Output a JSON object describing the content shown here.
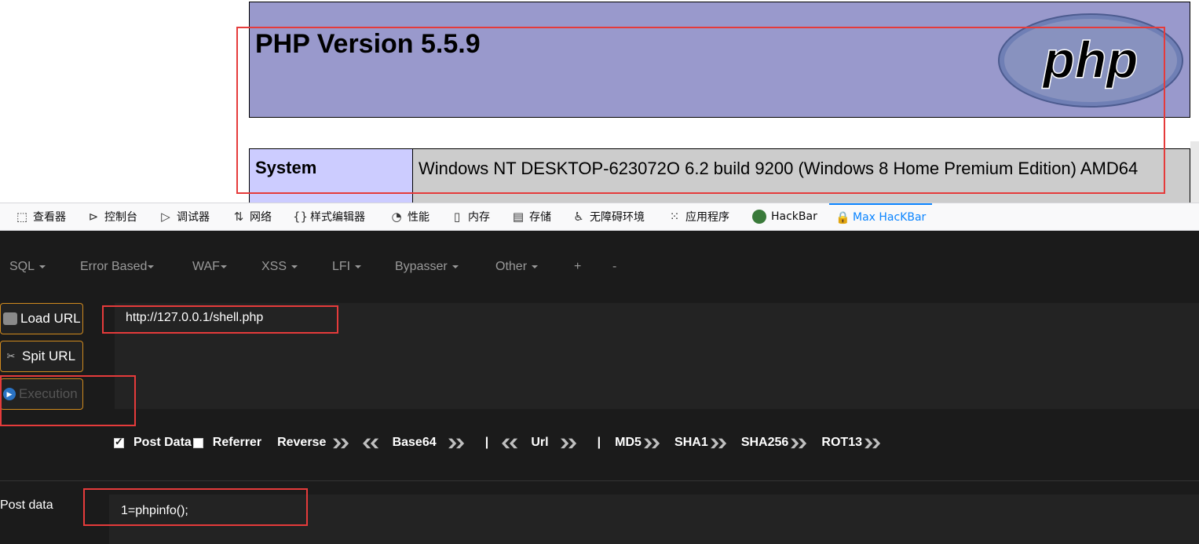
{
  "phpinfo": {
    "title": "PHP Version 5.5.9",
    "logo_text": "php",
    "system_key": "System",
    "system_value": "Windows NT DESKTOP-623072O 6.2 build 9200 (Windows 8 Home Premium Edition) AMD64"
  },
  "devtools": {
    "tabs": [
      {
        "label": "查看器",
        "icon": "inspector-icon"
      },
      {
        "label": "控制台",
        "icon": "console-icon"
      },
      {
        "label": "调试器",
        "icon": "debugger-icon"
      },
      {
        "label": "网络",
        "icon": "network-icon"
      },
      {
        "label": "样式编辑器",
        "icon": "style-editor-icon"
      },
      {
        "label": "性能",
        "icon": "performance-icon"
      },
      {
        "label": "内存",
        "icon": "memory-icon"
      },
      {
        "label": "存储",
        "icon": "storage-icon"
      },
      {
        "label": "无障碍环境",
        "icon": "accessibility-icon"
      },
      {
        "label": "应用程序",
        "icon": "application-icon"
      },
      {
        "label": "HackBar",
        "icon": "hackbar-icon"
      },
      {
        "label": "Max HacKBar",
        "icon": "max-hackbar-icon"
      }
    ],
    "active_tab": "Max HacKBar",
    "active_color": "#0a84ff"
  },
  "hackbar": {
    "menu": [
      "SQL",
      "Error Based",
      "WAF",
      "XSS",
      "LFI",
      "Bypasser",
      "Other",
      "+",
      "-"
    ],
    "buttons": {
      "load_url": "Load URL",
      "split_url": "Spit URL",
      "execution": "Execution"
    },
    "url_value": "http://127.0.0.1/shell.php",
    "options": {
      "post_data": "Post Data",
      "post_data_checked": true,
      "referrer": "Referrer",
      "referrer_checked": false,
      "reverse": "Reverse",
      "base64": "Base64",
      "sep1": "|",
      "url": "Url",
      "sep2": "|",
      "md5": "MD5",
      "sha1": "SHA1",
      "sha256": "SHA256",
      "rot13": "ROT13"
    },
    "post_label": "Post data",
    "post_value": "1=phpinfo();",
    "border_accent": "#d08a1e",
    "highlight_color": "#e53b3b"
  }
}
